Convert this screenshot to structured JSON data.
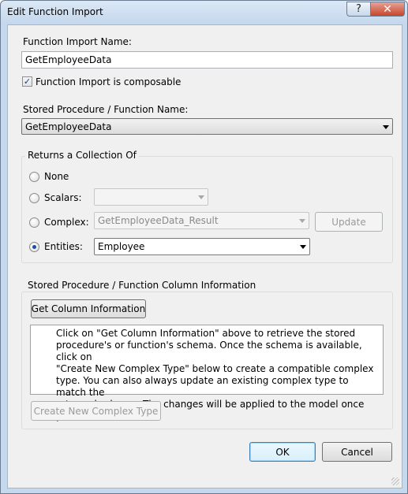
{
  "window": {
    "title": "Edit Function Import",
    "help_label": "?",
    "close_label": "✕"
  },
  "function_import_name": {
    "label": "Function Import Name:",
    "value": "GetEmployeeData"
  },
  "composable": {
    "label": "Function Import is composable",
    "checked": true,
    "check_mark": "✓"
  },
  "stored_procedure": {
    "label": "Stored Procedure / Function Name:",
    "value": "GetEmployeeData"
  },
  "returns": {
    "group_label": "Returns a Collection Of",
    "none_label": "None",
    "scalars_label": "Scalars:",
    "scalars_value": "",
    "complex_label": "Complex:",
    "complex_value": "GetEmployeeData_Result",
    "update_label": "Update",
    "entities_label": "Entities:",
    "entities_value": "Employee",
    "selected": "entities"
  },
  "column_info": {
    "group_label": "Stored Procedure / Function Column Information",
    "get_button_label": "Get Column Information",
    "message_lines": [
      "Click on \"Get Column Information\" above to retrieve the stored",
      "procedure's or function's schema. Once the schema is available, click on",
      "\"Create New Complex Type\" below to create a compatible complex",
      "type. You can also always update an existing complex type to match the",
      "returned schema. The changes will be applied to the model once you ..."
    ],
    "create_button_label": "Create New Complex Type"
  },
  "footer": {
    "ok_label": "OK",
    "cancel_label": "Cancel"
  }
}
